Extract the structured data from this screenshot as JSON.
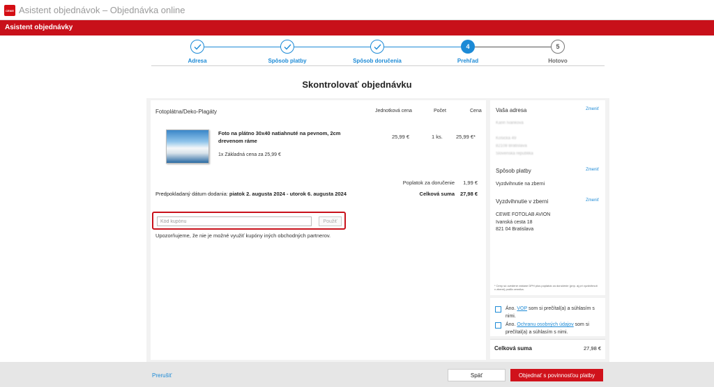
{
  "window": {
    "title": "Asistent objednávok – Objednávka online"
  },
  "app": {
    "logo_text": "CEWE",
    "header_title": "Asistent objednávky"
  },
  "stepper": {
    "steps": [
      {
        "label": "Adresa",
        "state": "done",
        "number": "1"
      },
      {
        "label": "Spôsob platby",
        "state": "done",
        "number": "2"
      },
      {
        "label": "Spôsob doručenia",
        "state": "done",
        "number": "3"
      },
      {
        "label": "Prehľad",
        "state": "current",
        "number": "4"
      },
      {
        "label": "Hotovo",
        "state": "todo",
        "number": "5"
      }
    ]
  },
  "page": {
    "heading": "Skontrolovať objednávku"
  },
  "cart": {
    "category": "Fotoplátna/Deko-Plagáty",
    "columns": {
      "unit_price": "Jednotková cena",
      "quantity": "Počet",
      "price": "Cena"
    },
    "item": {
      "title": "Foto na plátno 30x40 natiahnuté na pevnom, 2cm drevenom ráme",
      "base_price_note": "1x Základná cena za 25,99 €",
      "unit_price": "25,99 €",
      "quantity": "1 ks.",
      "price": "25,99 €*"
    },
    "shipping_fee_label": "Poplatok za doručenie",
    "shipping_fee_value": "1,99 €",
    "delivery_label": "Predpokladaný dátum dodania:",
    "delivery_value": "piatok 2. augusta 2024 - utorok 6. augusta 2024",
    "total_label": "Celková suma",
    "total_value": "27,98 €"
  },
  "coupon": {
    "placeholder": "Kód kupónu",
    "button_label": "Použiť",
    "note": "Upozorňujeme, že nie je možné využiť kupóny iných obchodných partnerov."
  },
  "sidebar": {
    "address": {
      "heading": "Vaša adresa",
      "change_label": "Zmeniť",
      "lines": [
        "Karin Ivanková",
        "Košická 49",
        "82108 Bratislava",
        "Slovenská republika"
      ]
    },
    "payment": {
      "heading": "Spôsob platby",
      "change_label": "Zmeniť",
      "value": "Vyzdvihnutie na zberni"
    },
    "pickup": {
      "heading": "Vyzdvihnutie v zberni",
      "change_label": "Zmeniť",
      "lines": [
        "CEWE FOTOLAB AVION",
        "Ivanská cesta 18",
        "821 04 Bratislava"
      ]
    },
    "fine_print": "* Ceny sú uvedené vrátane DPH plus poplatok za doručenie (príp. aj pri vyzdvihnutí v zberni) podľa cenníka."
  },
  "consent": {
    "vop": {
      "prefix": "Áno. ",
      "link": "VOP",
      "suffix": " som si prečítal(a) a súhlasím s nimi."
    },
    "privacy": {
      "prefix": "Áno. ",
      "link": "Ochranu osobných údajov",
      "suffix": " som si prečítal(a) a súhlasím s nimi."
    }
  },
  "summary": {
    "label": "Celková suma",
    "value": "27,98 €"
  },
  "footer": {
    "cancel_label": "Prerušiť",
    "back_label": "Späť",
    "order_label": "Objednať s povinnosťou platby"
  },
  "colors": {
    "brand_red": "#c8101a",
    "accent_blue": "#1c8ad6"
  },
  "icons": {
    "done_step": "check-icon"
  }
}
